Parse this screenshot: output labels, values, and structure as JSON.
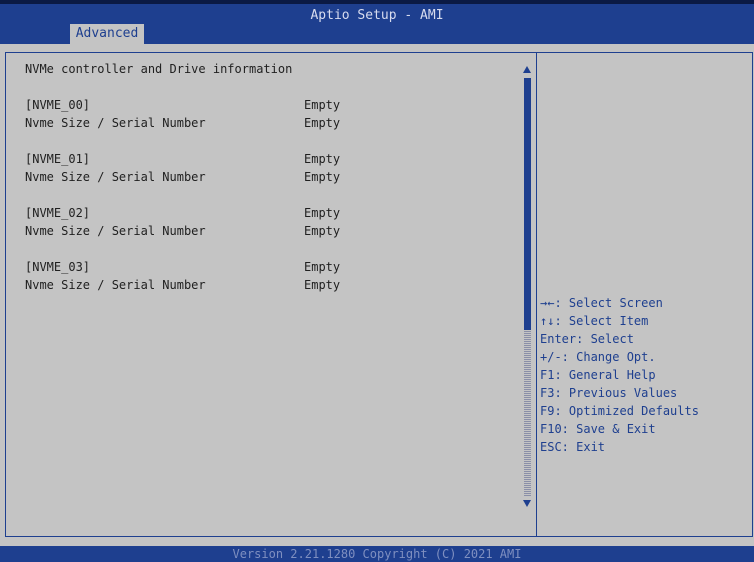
{
  "header": {
    "title": "Aptio Setup - AMI",
    "tab": "Advanced"
  },
  "main": {
    "heading": "NVMe controller and Drive information",
    "drives": [
      {
        "name": "[NVME_00]",
        "name_value": "Empty",
        "size_label": "Nvme Size / Serial Number",
        "size_value": "Empty"
      },
      {
        "name": "[NVME_01]",
        "name_value": "Empty",
        "size_label": "Nvme Size / Serial Number",
        "size_value": "Empty"
      },
      {
        "name": "[NVME_02]",
        "name_value": "Empty",
        "size_label": "Nvme Size / Serial Number",
        "size_value": "Empty"
      },
      {
        "name": "[NVME_03]",
        "name_value": "Empty",
        "size_label": "Nvme Size / Serial Number",
        "size_value": "Empty"
      }
    ]
  },
  "help": [
    "→←: Select Screen",
    "↑↓: Select Item",
    "Enter: Select",
    "+/-: Change Opt.",
    "F1: General Help",
    "F3: Previous Values",
    "F9: Optimized Defaults",
    "F10: Save & Exit",
    "ESC: Exit"
  ],
  "footer": {
    "version": "Version 2.21.1280 Copyright (C) 2021 AMI"
  },
  "colors": {
    "accent": "#1e3f8f",
    "background": "#c4c4c4"
  }
}
